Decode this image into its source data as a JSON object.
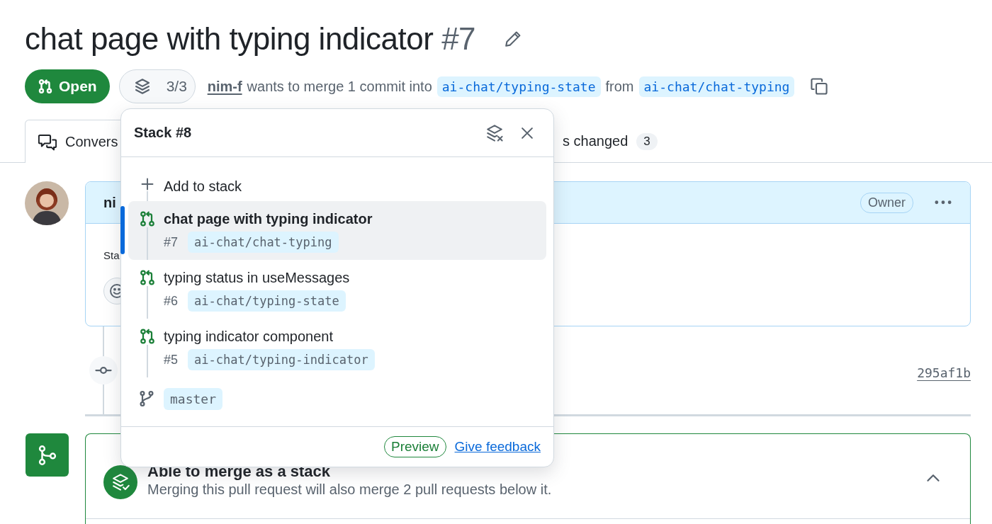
{
  "title": {
    "text": "chat page with typing indicator",
    "number": "#7"
  },
  "state_button": {
    "label": "Open"
  },
  "stack_button": {
    "label": "3/3"
  },
  "summary": {
    "author": "nim-f",
    "text": "wants to merge 1 commit into",
    "base_branch": "ai-chat/typing-state",
    "from": "from",
    "head_branch": "ai-chat/chat-typing"
  },
  "tabs": [
    {
      "label": "Convers",
      "selected": true
    },
    {
      "label": "s changed",
      "counter": "3",
      "selected": false
    }
  ],
  "comment": {
    "author": "ni",
    "badge": "Owner",
    "body": "Sta"
  },
  "commit": {
    "sha": "295af1b"
  },
  "merge_box": {
    "title": "Able to merge as a stack",
    "description": "Merging this pull request will also merge 2 pull requests below it."
  },
  "stack_popup": {
    "title": "Stack #8",
    "add_label": "Add to stack",
    "pulls": [
      {
        "title": "chat page with typing indicator",
        "number": "#7",
        "branch": "ai-chat/chat-typing",
        "selected": true
      },
      {
        "title": "typing status in useMessages",
        "number": "#6",
        "branch": "ai-chat/typing-state",
        "selected": false
      },
      {
        "title": "typing indicator component",
        "number": "#5",
        "branch": "ai-chat/typing-indicator",
        "selected": false
      }
    ],
    "base_branch": "master",
    "preview_label": "Preview",
    "feedback_link": "Give feedback"
  }
}
